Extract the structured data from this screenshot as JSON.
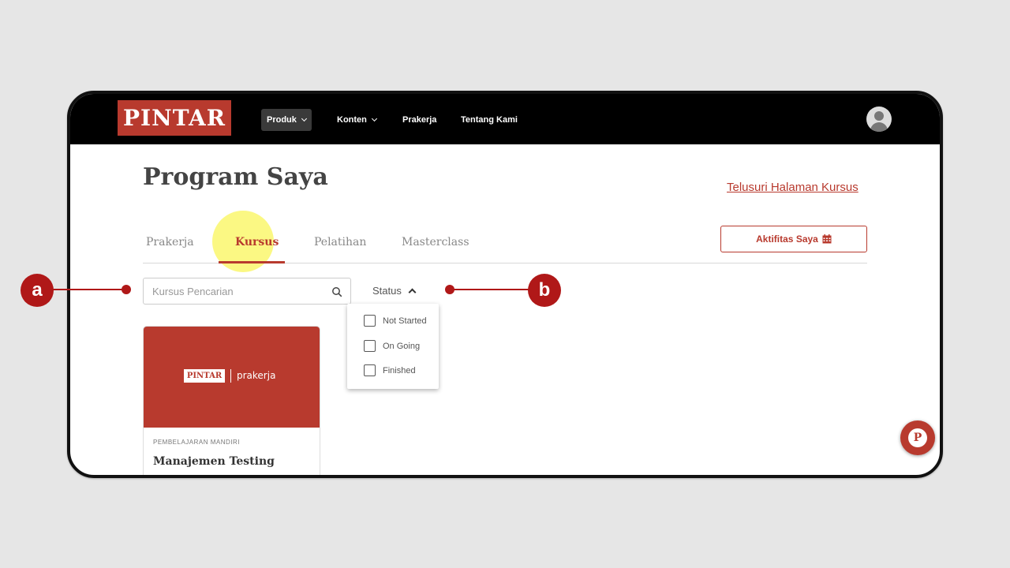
{
  "navbar": {
    "logo": "PINTAR",
    "items": [
      {
        "label": "Produk",
        "has_dropdown": true,
        "active": true
      },
      {
        "label": "Konten",
        "has_dropdown": true,
        "active": false
      },
      {
        "label": "Prakerja",
        "has_dropdown": false,
        "active": false
      },
      {
        "label": "Tentang Kami",
        "has_dropdown": false,
        "active": false
      }
    ],
    "avatar_icon": "user-avatar-icon"
  },
  "page": {
    "title": "Program Saya",
    "browse_link": "Telusuri Halaman Kursus",
    "tabs": [
      {
        "label": "Prakerja",
        "active": false
      },
      {
        "label": "Kursus",
        "active": true
      },
      {
        "label": "Pelatihan",
        "active": false
      },
      {
        "label": "Masterclass",
        "active": false
      }
    ],
    "activity_button": "Aktifitas Saya",
    "activity_icon": "calendar-icon"
  },
  "filters": {
    "search_placeholder": "Kursus Pencarian",
    "search_value": "",
    "status_label": "Status",
    "status_options": [
      {
        "label": "Not Started",
        "checked": false
      },
      {
        "label": "On Going",
        "checked": false
      },
      {
        "label": "Finished",
        "checked": false
      }
    ]
  },
  "course_card": {
    "banner_logo": "PINTAR",
    "banner_partner": "prakerja",
    "category": "PEMBELAJARAN MANDIRI",
    "title": "Manajemen Testing"
  },
  "callouts": {
    "a": "a",
    "b": "b"
  },
  "colors": {
    "brand": "#b83a2e",
    "navbar": "#000000",
    "callout": "#b01818",
    "highlight": "#faf55a"
  }
}
